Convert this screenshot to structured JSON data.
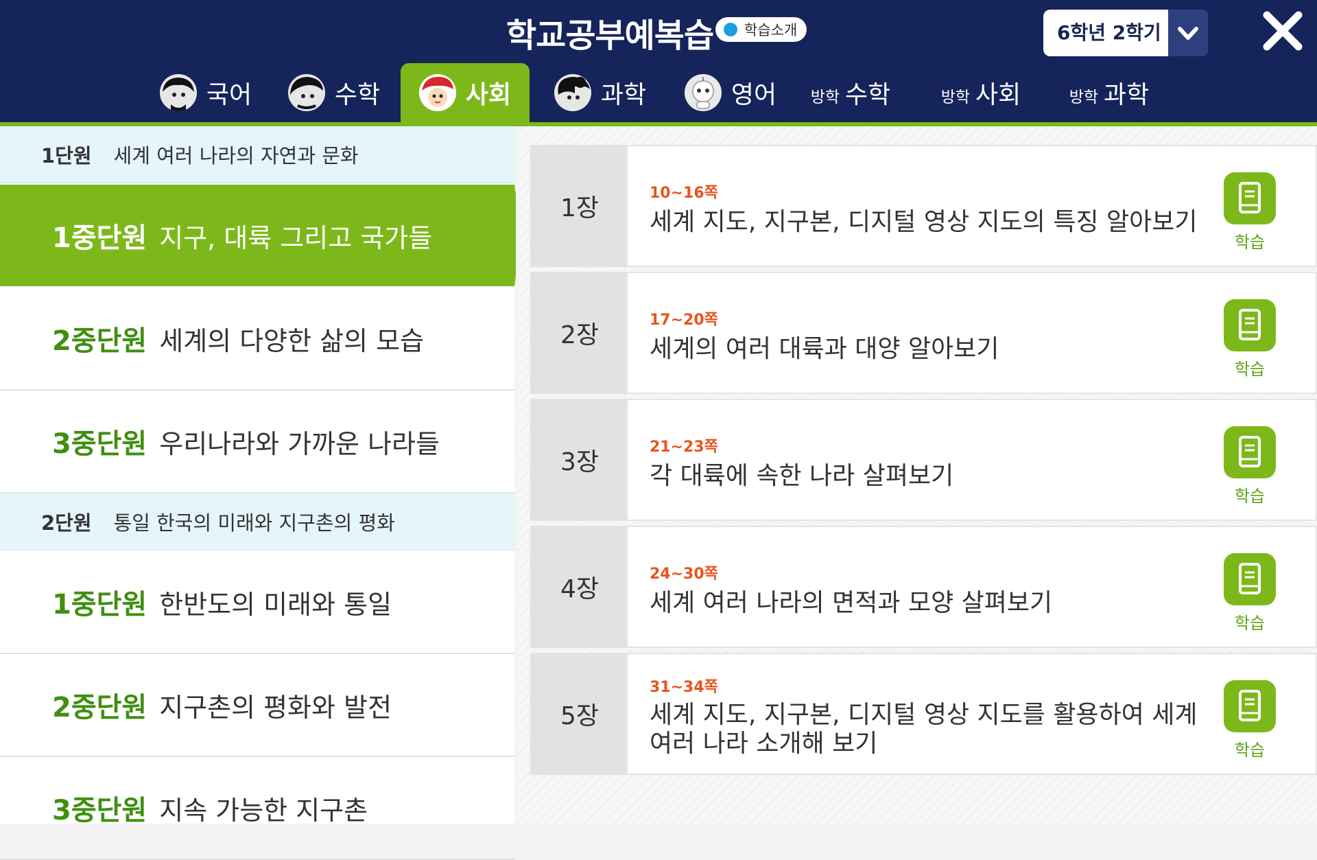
{
  "app": {
    "title": "학교공부예복습",
    "intro_badge": "학습소개",
    "grade_selector": "6학년 2학기",
    "accent_color": "#7db81a",
    "header_color": "#15245a"
  },
  "tabs": [
    {
      "label": "국어",
      "icon": "korean-avatar-icon"
    },
    {
      "label": "수학",
      "icon": "math-avatar-icon"
    },
    {
      "label": "사회",
      "icon": "social-avatar-icon",
      "active": true
    },
    {
      "label": "과학",
      "icon": "science-avatar-icon"
    },
    {
      "label": "영어",
      "icon": "english-robot-icon"
    },
    {
      "prefix": "방학",
      "label": "수학"
    },
    {
      "prefix": "방학",
      "label": "사회"
    },
    {
      "prefix": "방학",
      "label": "과학"
    }
  ],
  "units": [
    {
      "number": "1단원",
      "title": "세계 여러 나라의 자연과 문화"
    },
    {
      "number": "2단원",
      "title": "통일 한국의 미래와 지구촌의 평화"
    }
  ],
  "subunits": [
    {
      "number": "1중단원",
      "title": "지구, 대륙 그리고 국가들",
      "active": true
    },
    {
      "number": "2중단원",
      "title": "세계의 다양한 삶의 모습"
    },
    {
      "number": "3중단원",
      "title": "우리나라와 가까운 나라들"
    },
    {
      "number": "1중단원",
      "title": "한반도의 미래와 통일"
    },
    {
      "number": "2중단원",
      "title": "지구촌의 평화와 발전"
    },
    {
      "number": "3중단원",
      "title": "지속 가능한 지구촌"
    }
  ],
  "chapters": [
    {
      "number": "1장",
      "pages": "10~16쪽",
      "title": "세계 지도, 지구본, 디지털 영상 지도의 특징 알아보기",
      "action": "학습"
    },
    {
      "number": "2장",
      "pages": "17~20쪽",
      "title": "세계의 여러 대륙과 대양 알아보기",
      "action": "학습"
    },
    {
      "number": "3장",
      "pages": "21~23쪽",
      "title": "각 대륙에 속한 나라 살펴보기",
      "action": "학습"
    },
    {
      "number": "4장",
      "pages": "24~30쪽",
      "title": "세계 여러 나라의 면적과 모양 살펴보기",
      "action": "학습"
    },
    {
      "number": "5장",
      "pages": "31~34쪽",
      "title": "세계 지도, 지구본, 디지털 영상 지도를 활용하여 세계 여러 나라 소개해 보기",
      "action": "학습"
    }
  ]
}
